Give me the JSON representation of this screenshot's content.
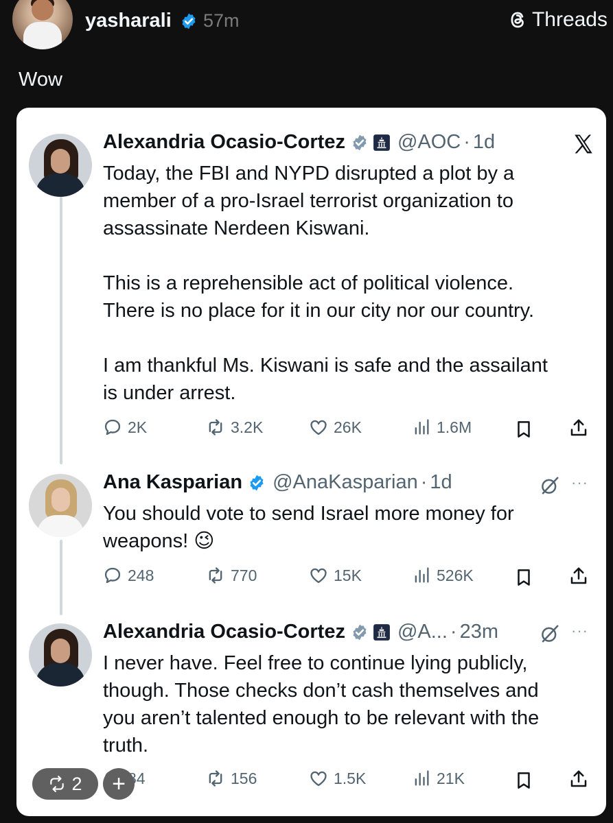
{
  "threads_post": {
    "username": "yasharali",
    "time_ago": "57m",
    "brand": "Threads",
    "caption": "Wow"
  },
  "x_card": {
    "tweets": [
      {
        "name": "Alexandria Ocasio-Cortez",
        "handle": "@AOC",
        "time": "1d",
        "text": "Today, the FBI and NYPD disrupted a plot by a\nmember of a pro-Israel terrorist organization to\nassassinate Nerdeen Kiswani.\n\nThis is a reprehensible act of political violence.\nThere is no place for it in our city nor our country.\n\nI am thankful Ms. Kiswani is safe and the assailant\nis under arrest.",
        "replies": "2K",
        "reposts": "3.2K",
        "likes": "26K",
        "views": "1.6M"
      },
      {
        "name": "Ana Kasparian",
        "handle": "@AnaKasparian",
        "time": "1d",
        "text": "You should vote to send Israel more money for\nweapons! 😉",
        "replies": "248",
        "reposts": "770",
        "likes": "15K",
        "views": "526K"
      },
      {
        "name": "Alexandria Ocasio-Cortez",
        "handle": "@A...",
        "time": "23m",
        "text": "I never have. Feel free to continue lying publicly,\nthough. Those checks don’t cash themselves and\nyou aren’t talented enough to be relevant with the\ntruth.",
        "replies": "84",
        "reposts": "156",
        "likes": "1.5K",
        "views": "21K"
      }
    ]
  },
  "overlay": {
    "repost_count": "2",
    "plus": "+"
  },
  "colors": {
    "background": "#101010",
    "card": "#ffffff",
    "verified_blue": "#1d9bf0",
    "muted": "#536471"
  }
}
